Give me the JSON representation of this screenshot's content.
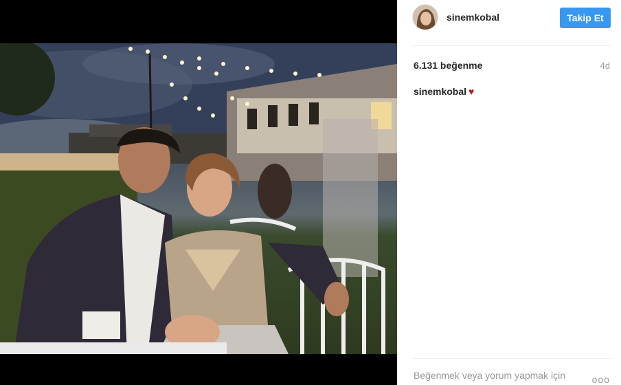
{
  "post": {
    "username": "sinemkobal",
    "follow_label": "Takip Et",
    "likes": "6.131 beğenme",
    "time_ago": "4d",
    "caption_user": "sinemkobal",
    "caption_emoji": "♥",
    "login_prompt": "Beğenmek veya yorum yapmak için",
    "more_label": "ooo"
  },
  "colors": {
    "follow_button": "#3897f0",
    "heart": "#c01818"
  }
}
